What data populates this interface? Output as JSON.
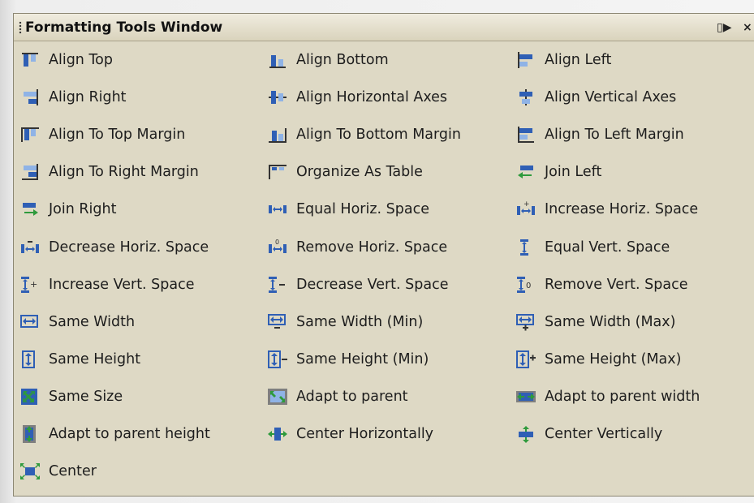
{
  "window": {
    "title": "Formatting Tools Window",
    "pin_glyph": "▯▶",
    "close_glyph": "×"
  },
  "colors": {
    "background": "#ded9c5",
    "icon_blue": "#2f5fb5",
    "icon_green": "#2e9a3c"
  },
  "tools": [
    {
      "label": "Align Top",
      "icon": "align-top-icon"
    },
    {
      "label": "Align Bottom",
      "icon": "align-bottom-icon"
    },
    {
      "label": "Align Left",
      "icon": "align-left-icon"
    },
    {
      "label": "Align Right",
      "icon": "align-right-icon"
    },
    {
      "label": "Align Horizontal Axes",
      "icon": "align-horizontal-axes-icon"
    },
    {
      "label": "Align Vertical Axes",
      "icon": "align-vertical-axes-icon"
    },
    {
      "label": "Align To Top Margin",
      "icon": "align-to-top-margin-icon"
    },
    {
      "label": "Align To Bottom Margin",
      "icon": "align-to-bottom-margin-icon"
    },
    {
      "label": "Align To Left Margin",
      "icon": "align-to-left-margin-icon"
    },
    {
      "label": "Align To Right Margin",
      "icon": "align-to-right-margin-icon"
    },
    {
      "label": "Organize As Table",
      "icon": "organize-as-table-icon"
    },
    {
      "label": "Join Left",
      "icon": "join-left-icon"
    },
    {
      "label": "Join Right",
      "icon": "join-right-icon"
    },
    {
      "label": "Equal Horiz. Space",
      "icon": "equal-horiz-space-icon"
    },
    {
      "label": "Increase Horiz. Space",
      "icon": "increase-horiz-space-icon"
    },
    {
      "label": "Decrease Horiz. Space",
      "icon": "decrease-horiz-space-icon"
    },
    {
      "label": "Remove Horiz. Space",
      "icon": "remove-horiz-space-icon"
    },
    {
      "label": "Equal Vert. Space",
      "icon": "equal-vert-space-icon"
    },
    {
      "label": "Increase Vert. Space",
      "icon": "increase-vert-space-icon"
    },
    {
      "label": "Decrease Vert. Space",
      "icon": "decrease-vert-space-icon"
    },
    {
      "label": "Remove Vert. Space",
      "icon": "remove-vert-space-icon"
    },
    {
      "label": "Same Width",
      "icon": "same-width-icon"
    },
    {
      "label": "Same Width (Min)",
      "icon": "same-width-min-icon"
    },
    {
      "label": "Same Width (Max)",
      "icon": "same-width-max-icon"
    },
    {
      "label": "Same Height",
      "icon": "same-height-icon"
    },
    {
      "label": "Same Height (Min)",
      "icon": "same-height-min-icon"
    },
    {
      "label": "Same Height (Max)",
      "icon": "same-height-max-icon"
    },
    {
      "label": "Same Size",
      "icon": "same-size-icon"
    },
    {
      "label": "Adapt to parent",
      "icon": "adapt-to-parent-icon"
    },
    {
      "label": "Adapt to parent width",
      "icon": "adapt-to-parent-width-icon"
    },
    {
      "label": "Adapt to parent height",
      "icon": "adapt-to-parent-height-icon"
    },
    {
      "label": "Center Horizontally",
      "icon": "center-horizontally-icon"
    },
    {
      "label": "Center Vertically",
      "icon": "center-vertically-icon"
    },
    {
      "label": "Center",
      "icon": "center-icon"
    }
  ]
}
